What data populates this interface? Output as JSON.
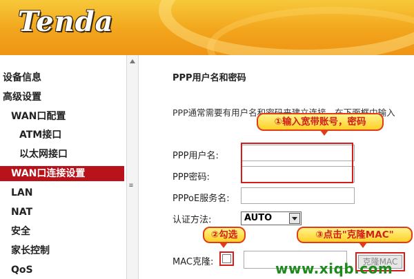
{
  "header": {
    "logo": "Tenda"
  },
  "sidebar": {
    "items": [
      {
        "label": "设备信息"
      },
      {
        "label": "高级设置"
      },
      {
        "label": "WAN口配置"
      },
      {
        "label": "ATM接口"
      },
      {
        "label": "以太网接口"
      },
      {
        "label": "WAN口连接设置"
      },
      {
        "label": "LAN"
      },
      {
        "label": "NAT"
      },
      {
        "label": "安全"
      },
      {
        "label": "家长控制"
      },
      {
        "label": "QoS"
      }
    ],
    "active_index": 5
  },
  "splitter": {
    "grip_glyph": "≡"
  },
  "main": {
    "section_title": "PPP用户名和密码",
    "description": "PPP通常需要有用户名和密码来建立连接。在下面框中输入",
    "fields": {
      "ppp_username_label": "PPP用户名:",
      "ppp_username_value": "",
      "ppp_password_label": "PPP密码:",
      "ppp_password_value": "",
      "pppoe_service_label": "PPPoE服务名:",
      "pppoe_service_value": "",
      "auth_label": "认证方法:",
      "auth_value": "AUTO",
      "mac_clone_label": "MAC克隆:",
      "mac_clone_checked": false,
      "mac_value": "",
      "clone_button": "克隆MAC"
    }
  },
  "annotations": {
    "callout1": "①输入宽带账号，密码",
    "callout2": "②勾选",
    "callout3": "③点击\"克隆MAC\"",
    "highlight_color": "#d61b1b"
  },
  "watermark": "www.xiqb.com",
  "colors": {
    "active_nav_bg": "#b8131b",
    "header_orange": "#f2a51c",
    "watermark_green": "#1e8a1e"
  }
}
